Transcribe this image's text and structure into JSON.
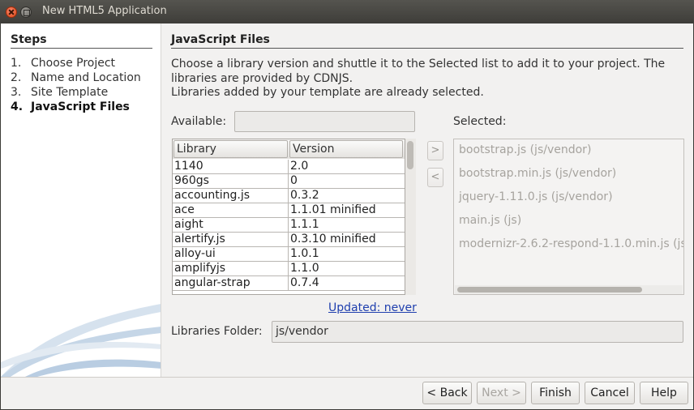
{
  "window": {
    "title": "New HTML5 Application"
  },
  "steps": {
    "title": "Steps",
    "items": [
      {
        "num": "1.",
        "label": "Choose Project"
      },
      {
        "num": "2.",
        "label": "Name and Location"
      },
      {
        "num": "3.",
        "label": "Site Template"
      },
      {
        "num": "4.",
        "label": "JavaScript Files"
      }
    ]
  },
  "main": {
    "title": "JavaScript Files",
    "description": [
      "Choose a library version and shuttle it to the Selected list to add it to your project. The",
      "libraries are provided by CDNJS.",
      "Libraries added by your template are already selected."
    ],
    "available_label": "Available:",
    "available_value": "",
    "selected_label": "Selected:",
    "table": {
      "headers": [
        "Library",
        "Version"
      ],
      "rows": [
        {
          "library": "1140",
          "version": "2.0"
        },
        {
          "library": "960gs",
          "version": "0"
        },
        {
          "library": "accounting.js",
          "version": "0.3.2"
        },
        {
          "library": "ace",
          "version": "1.1.01 minified"
        },
        {
          "library": "aight",
          "version": "1.1.1"
        },
        {
          "library": "alertify.js",
          "version": "0.3.10 minified"
        },
        {
          "library": "alloy-ui",
          "version": "1.0.1"
        },
        {
          "library": "amplifyjs",
          "version": "1.1.0"
        },
        {
          "library": "angular-strap",
          "version": "0.7.4"
        }
      ]
    },
    "add_button": ">",
    "remove_button": "<",
    "selected_items": [
      "bootstrap.js (js/vendor)",
      "bootstrap.min.js (js/vendor)",
      "jquery-1.11.0.js (js/vendor)",
      "main.js (js)",
      "modernizr-2.6.2-respond-1.1.0.min.js (js/"
    ],
    "updated_link": "Updated: never",
    "folder_label": "Libraries Folder:",
    "folder_value": "js/vendor"
  },
  "buttons": {
    "back": "< Back",
    "next": "Next >",
    "finish": "Finish",
    "cancel": "Cancel",
    "help": "Help"
  }
}
